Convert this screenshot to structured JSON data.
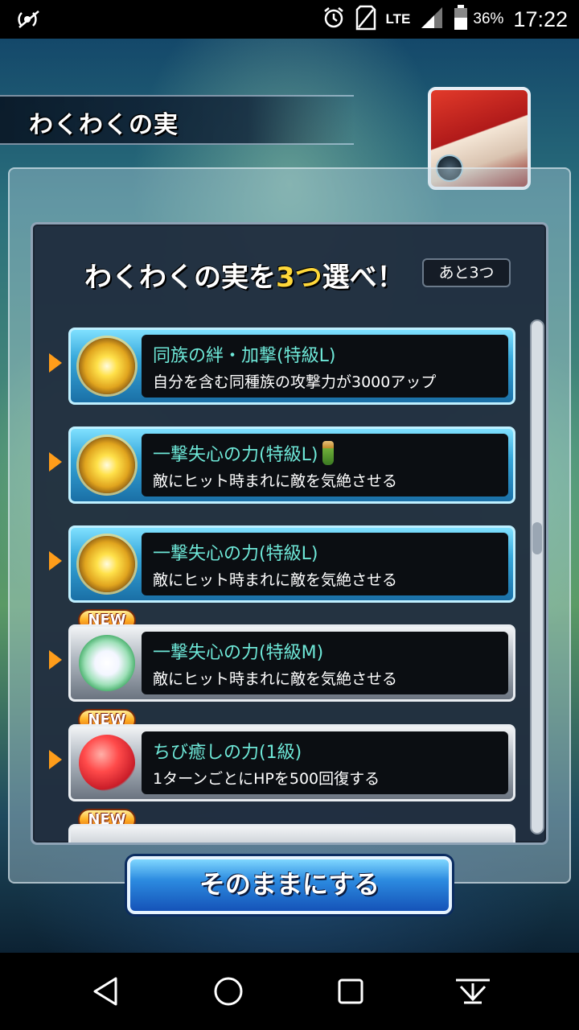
{
  "status_bar": {
    "network": "LTE",
    "battery_percent": "36%",
    "time": "17:22",
    "icons": [
      "signal-broadcast-icon",
      "alarm-icon",
      "sim-icon",
      "lte-signal-icon",
      "battery-icon"
    ]
  },
  "screen": {
    "title": "わくわくの実",
    "prompt_prefix": "わくわくの実を",
    "prompt_highlight": "3つ",
    "prompt_suffix": "選べ！",
    "remaining": "あと3つ",
    "new_label": "NEW",
    "fruits": [
      {
        "name": "同族の絆・加撃(特級L)",
        "description": "自分を含む同種族の攻撃力が3000アップ",
        "icon": "golden-sun-fruit-icon",
        "frame": "gold",
        "is_new": false,
        "has_bottle": false
      },
      {
        "name": "一撃失心の力(特級L)",
        "description": "敵にヒット時まれに敵を気絶させる",
        "icon": "golden-sun-fruit-icon",
        "frame": "gold",
        "is_new": false,
        "has_bottle": true
      },
      {
        "name": "一撃失心の力(特級L)",
        "description": "敵にヒット時まれに敵を気絶させる",
        "icon": "golden-sun-fruit-icon",
        "frame": "gold",
        "is_new": false,
        "has_bottle": false
      },
      {
        "name": "一撃失心の力(特級M)",
        "description": "敵にヒット時まれに敵を気絶させる",
        "icon": "lotus-fruit-icon",
        "frame": "silver",
        "is_new": true,
        "has_bottle": false
      },
      {
        "name": "ちび癒しの力(1級)",
        "description": "1ターンごとにHPを500回復する",
        "icon": "red-apple-fruit-icon",
        "frame": "silver",
        "is_new": true,
        "has_bottle": false
      }
    ],
    "action_button": "そのままにする"
  },
  "nav_bar": {
    "icons": [
      "back-triangle-icon",
      "home-circle-icon",
      "recents-square-icon",
      "keyboard-hide-icon"
    ]
  },
  "colors": {
    "name_text": "#6ee8d8",
    "highlight": "#ffd83a",
    "pointer": "#ff9d1a",
    "button_blue": "#2c8be0"
  }
}
